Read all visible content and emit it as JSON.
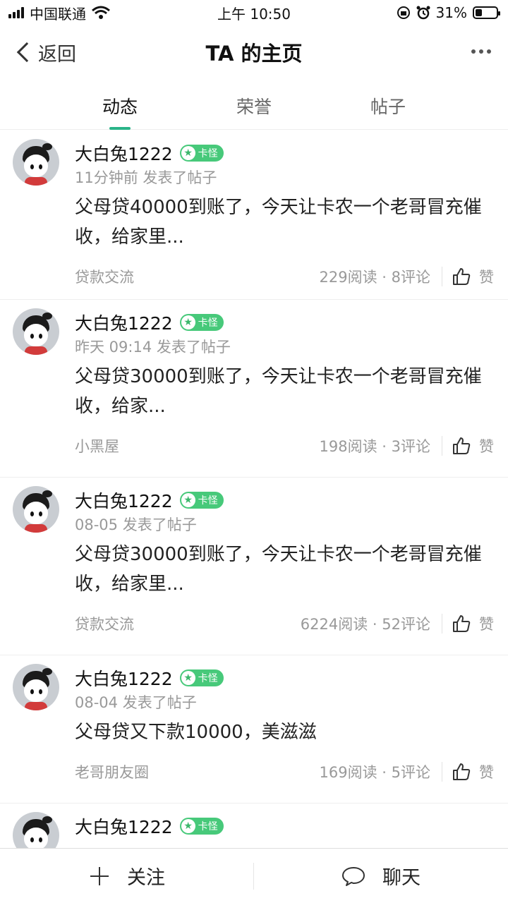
{
  "status_bar": {
    "carrier": "中国联通",
    "time": "上午 10:50",
    "battery_pct": "31%",
    "battery_fraction": 0.31
  },
  "nav": {
    "back_label": "返回",
    "title": "TA 的主页"
  },
  "tabs": [
    {
      "label": "动态",
      "active": true
    },
    {
      "label": "荣誉",
      "active": false
    },
    {
      "label": "帖子",
      "active": false
    }
  ],
  "posts": [
    {
      "username": "大白兔1222",
      "badge": "卡怪",
      "meta": "11分钟前 发表了帖子",
      "content": "父母贷40000到账了，今天让卡农一个老哥冒充催收，给家里...",
      "category": "贷款交流",
      "stats": "229阅读 · 8评论",
      "like_label": "赞"
    },
    {
      "username": "大白兔1222",
      "badge": "卡怪",
      "meta": "昨天 09:14 发表了帖子",
      "content": "父母贷30000到账了，今天让卡农一个老哥冒充催收，给家...",
      "category": "小黑屋",
      "stats": "198阅读 · 3评论",
      "like_label": "赞"
    },
    {
      "username": "大白兔1222",
      "badge": "卡怪",
      "meta": "08-05 发表了帖子",
      "content": "父母贷30000到账了，今天让卡农一个老哥冒充催收，给家里...",
      "category": "贷款交流",
      "stats": "6224阅读 · 52评论",
      "like_label": "赞"
    },
    {
      "username": "大白兔1222",
      "badge": "卡怪",
      "meta": "08-04 发表了帖子",
      "content": "父母贷又下款10000，美滋滋",
      "category": "老哥朋友圈",
      "stats": "169阅读 · 5评论",
      "like_label": "赞"
    },
    {
      "username": "大白兔1222",
      "badge": "卡怪"
    }
  ],
  "bottom_bar": {
    "follow_label": "关注",
    "chat_label": "聊天"
  },
  "colors": {
    "accent": "#2ab488",
    "badge": "#47c97a"
  }
}
